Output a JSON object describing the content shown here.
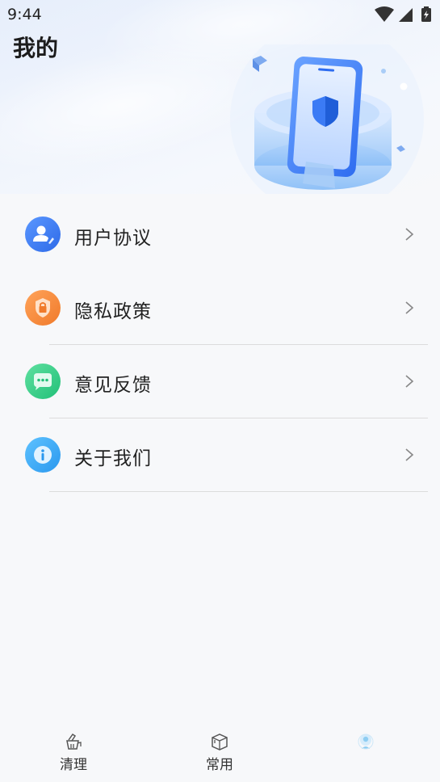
{
  "status_bar": {
    "time": "9:44",
    "icons": [
      "wifi-icon",
      "signal-icon",
      "battery-charging-icon"
    ]
  },
  "header": {
    "title": "我的"
  },
  "menu": {
    "items": [
      {
        "label": "用户协议",
        "icon": "user-agreement-icon",
        "color": "#3a7af0"
      },
      {
        "label": "隐私政策",
        "icon": "privacy-lock-icon",
        "color": "#f08a3e"
      },
      {
        "label": "意见反馈",
        "icon": "feedback-chat-icon",
        "color": "#3dd08a"
      },
      {
        "label": "关于我们",
        "icon": "info-icon",
        "color": "#3aa9f0"
      }
    ]
  },
  "bottom_nav": {
    "items": [
      {
        "label": "清理",
        "icon": "broom-icon"
      },
      {
        "label": "常用",
        "icon": "box-icon"
      },
      {
        "label": "",
        "icon": "profile-icon",
        "active": true
      }
    ]
  }
}
